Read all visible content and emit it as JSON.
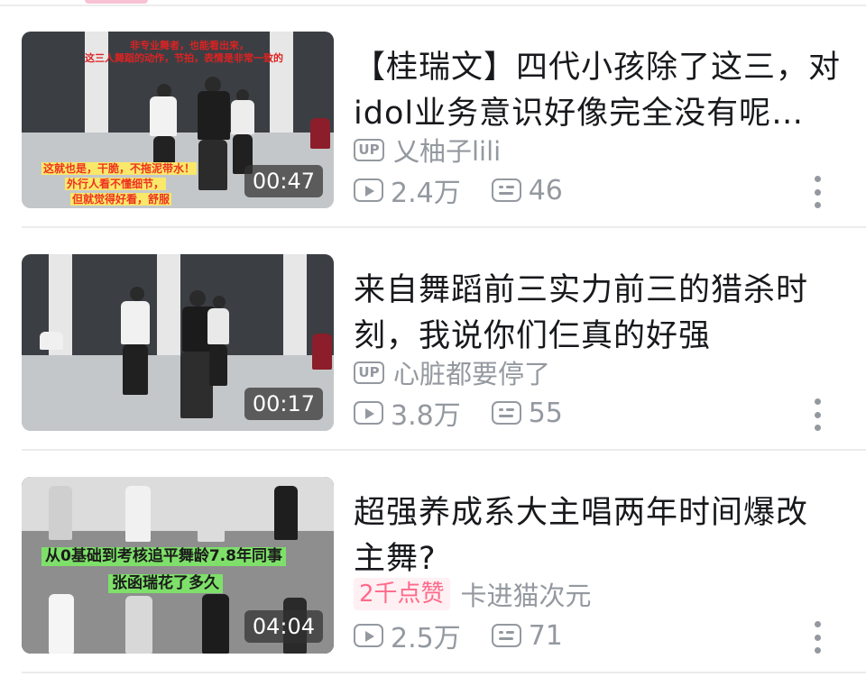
{
  "feed": {
    "items": [
      {
        "title": "【桂瑞文】四代小孩除了这三，对idol业务意识好像完全没有呢…",
        "title_line1": "【桂瑞文】四代小孩除了这三，对",
        "title_line2": "idol业务意识好像完全没有呢…",
        "up_label": "UP",
        "author": "乂柚子lili",
        "views": "2.4万",
        "danmaku": "46",
        "duration": "00:47",
        "thumb_captions": [
          "非专业舞者，也能看出来，",
          "这三人舞蹈的动作，节拍，表情是非常一致的",
          "这就也是，干脆，不拖泥带水！",
          "外行人看不懂细节，",
          "但就觉得好看，舒服"
        ]
      },
      {
        "title": "来自舞蹈前三实力前三的猎杀时刻，我说你们仨真的好强",
        "title_line1": "来自舞蹈前三实力前三的猎杀时",
        "title_line2": "刻，我说你们仨真的好强",
        "up_label": "UP",
        "author": "心脏都要停了",
        "views": "3.8万",
        "danmaku": "55",
        "duration": "00:17"
      },
      {
        "title": "超强养成系大主唱两年时间爆改主舞?",
        "title_line1": "超强养成系大主唱两年时间爆改",
        "title_line2": "主舞?",
        "like_badge": "2千点赞",
        "author": "卡进猫次元",
        "views": "2.5万",
        "danmaku": "71",
        "duration": "04:04",
        "thumb_captions": [
          "从0基础到考核追平舞龄7.8年同事",
          "张函瑞花了多久"
        ]
      }
    ]
  },
  "icons": {
    "play": "play-count-icon",
    "danmaku": "danmaku-count-icon",
    "more": "more-vertical-icon"
  },
  "colors": {
    "meta_gray": "#9499a0",
    "title_black": "#18191c",
    "like_pink": "#ff6a8a"
  }
}
